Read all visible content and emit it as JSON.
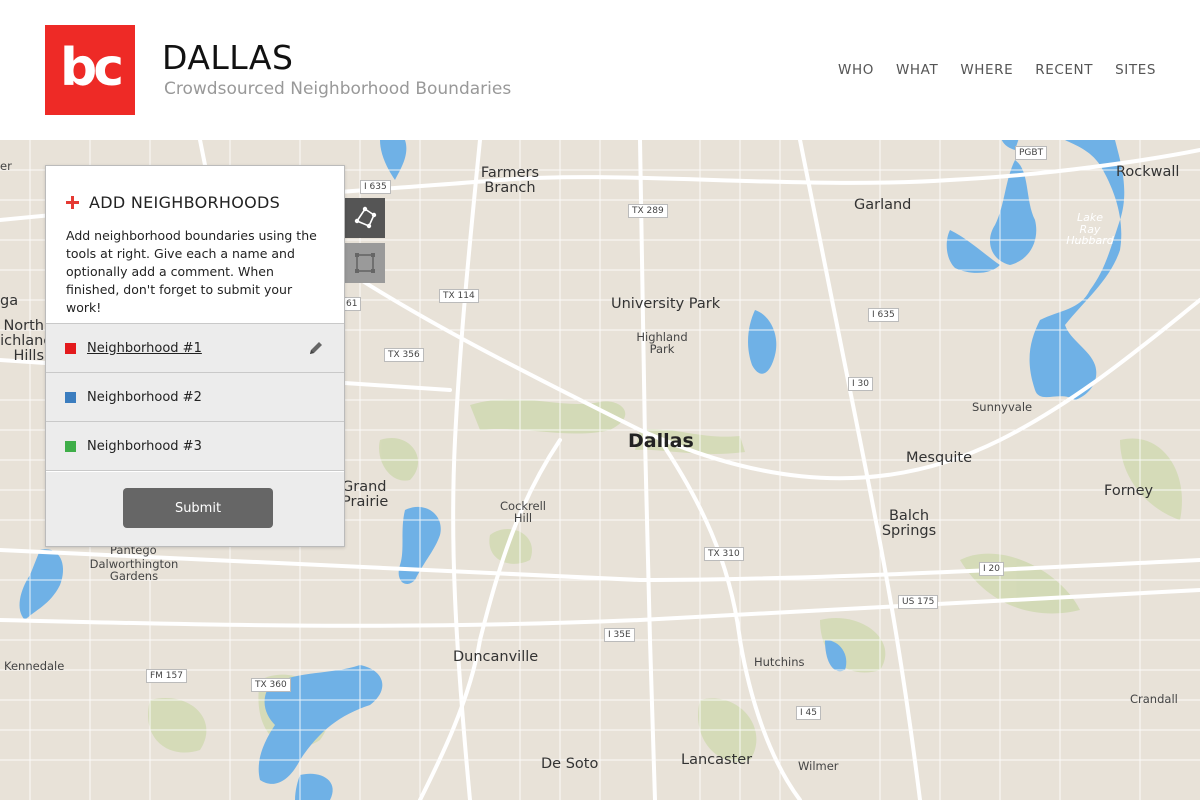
{
  "header": {
    "logo_text": "bc",
    "title": "DALLAS",
    "subtitle": "Crowdsourced Neighborhood Boundaries",
    "nav": [
      "WHO",
      "WHAT",
      "WHERE",
      "RECENT",
      "SITES"
    ]
  },
  "panel": {
    "title": "ADD NEIGHBORHOODS",
    "description": "Add neighborhood boundaries using the tools at right. Give each a name and optionally add a comment. When finished, don't forget to submit your work!",
    "neighborhoods": [
      {
        "label": "Neighborhood #1",
        "color": "#e31a1c"
      },
      {
        "label": "Neighborhood #2",
        "color": "#3b7dbf"
      },
      {
        "label": "Neighborhood #3",
        "color": "#3fae49"
      }
    ],
    "submit_label": "Submit"
  },
  "map": {
    "places": {
      "farmers_branch": "Farmers Branch",
      "garland": "Garland",
      "rockwall": "Rockwall",
      "university_park": "University Park",
      "highland_park": "Highland Park",
      "dallas": "Dallas",
      "mesquite": "Mesquite",
      "sunnyvale": "Sunnyvale",
      "forney": "Forney",
      "north_richland_hills": "North Richland Hills",
      "grand_prairie": "Grand Prairie",
      "cockrell_hill": "Cockrell Hill",
      "balch_springs": "Balch Springs",
      "pantego": "Pantego",
      "dalworthington_gardens": "Dalworthington Gardens",
      "kennedale": "Kennedale",
      "duncanville": "Duncanville",
      "hutchins": "Hutchins",
      "crandall": "Crandall",
      "de_soto": "De Soto",
      "lancaster": "Lancaster",
      "wilmer": "Wilmer",
      "lake_ray_hubbard": "Lake Ray Hubbard",
      "partial_left_top": "er",
      "partial_left_mid": "ga"
    },
    "shields": {
      "i635_nw": "I 635",
      "tx289": "TX 289",
      "pgbt": "PGBT",
      "tx114": "TX 114",
      "tx356": "TX 356",
      "i635_e": "I 635",
      "i30": "I 30",
      "tx310": "TX 310",
      "i20": "I 20",
      "us175": "US 175",
      "i35e": "I 35E",
      "fm157": "FM 157",
      "tx360": "TX 360",
      "i45": "I 45",
      "partial_161": "61"
    }
  }
}
